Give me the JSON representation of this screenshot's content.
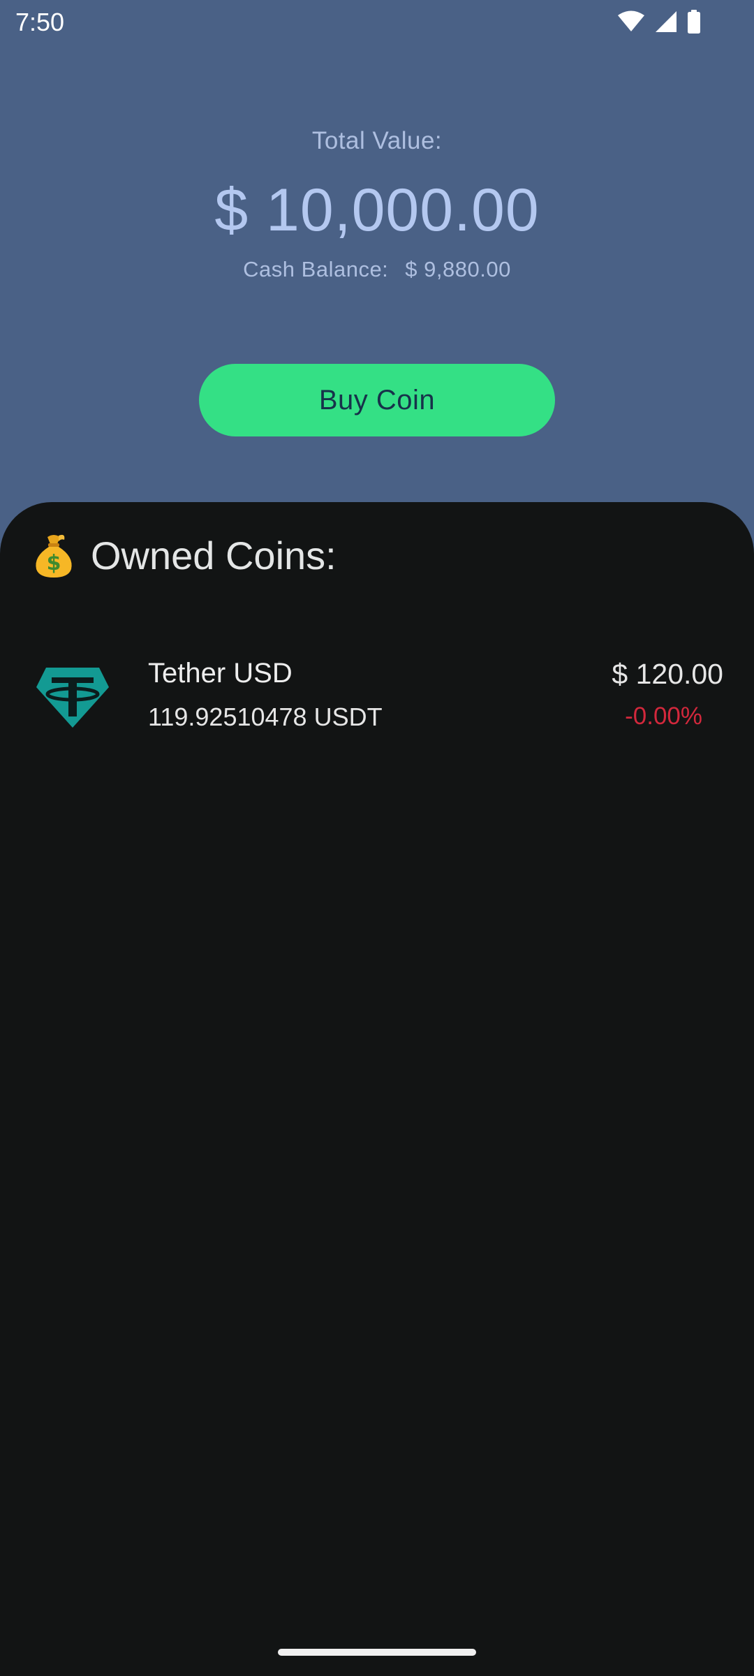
{
  "status_bar": {
    "time": "7:50",
    "icons": [
      "wifi-icon",
      "signal-icon",
      "battery-icon"
    ]
  },
  "portfolio": {
    "total_label": "Total Value:",
    "total_value": "$ 10,000.00",
    "cash_label": "Cash Balance:",
    "cash_value": "$ 9,880.00"
  },
  "buy_button": {
    "label": "Buy Coin"
  },
  "owned": {
    "title": "Owned Coins:",
    "title_icon": "money-bag-icon",
    "coins": [
      {
        "name": "Tether USD",
        "amount": "119.92510478 USDT",
        "value": "$ 120.00",
        "change": "-0.00%",
        "logo": "tether-logo-icon"
      }
    ]
  },
  "colors": {
    "header_bg": "#4a6186",
    "sheet_bg": "#121414",
    "button_bg": "#34e085",
    "negative": "#d2283c",
    "tether": "#139a93"
  }
}
